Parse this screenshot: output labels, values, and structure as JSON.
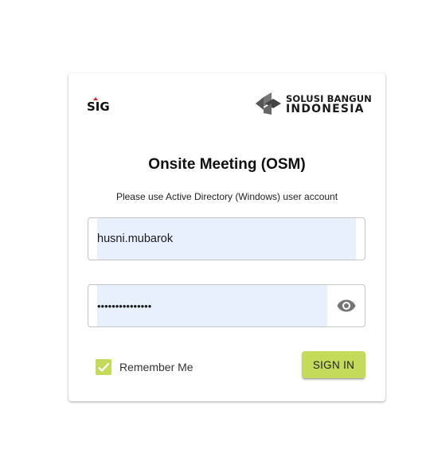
{
  "logos": {
    "sig_text": "SIG",
    "brand_line1": "SOLUSI BANGUN",
    "brand_line2": "INDONESIA"
  },
  "title": "Onsite Meeting (OSM)",
  "subtitle": "Please use Active Directory (Windows) user account",
  "username": {
    "value": "husni.mubarok"
  },
  "password": {
    "value": "passwordpasswor",
    "icon": "eye-icon"
  },
  "remember": {
    "label": "Remember Me",
    "checked": true
  },
  "signin_label": "SIGN IN",
  "colors": {
    "accent": "#c4da5a",
    "autofill": "#e8f0fe",
    "brand_red": "#d32027",
    "brand_gray": "#666666"
  }
}
